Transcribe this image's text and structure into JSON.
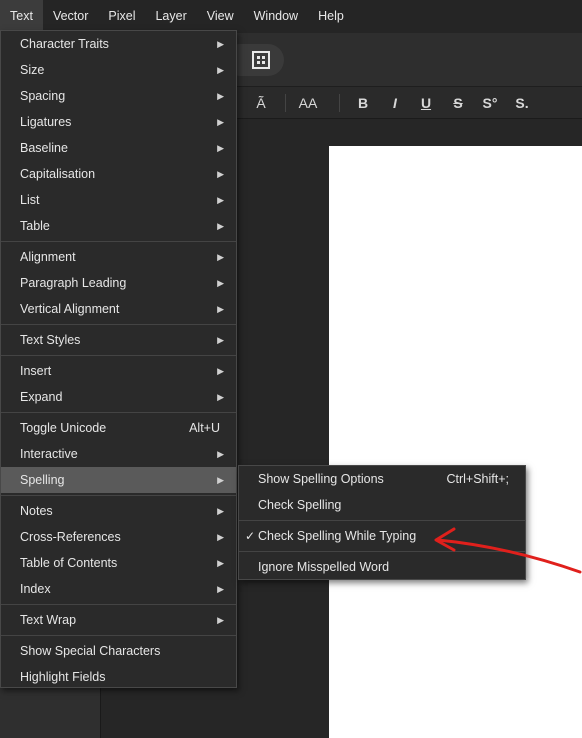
{
  "menubar": {
    "items": [
      "Text",
      "Vector",
      "Pixel",
      "Layer",
      "View",
      "Window",
      "Help"
    ],
    "active": "Text"
  },
  "format_toolbar": {
    "buttons": [
      "Ã",
      "AA",
      "B",
      "I",
      "U",
      "S",
      "S°",
      "S."
    ]
  },
  "text_menu": {
    "groups": [
      [
        {
          "label": "Character Traits",
          "submenu": true
        },
        {
          "label": "Size",
          "submenu": true
        },
        {
          "label": "Spacing",
          "submenu": true
        },
        {
          "label": "Ligatures",
          "submenu": true
        },
        {
          "label": "Baseline",
          "submenu": true
        },
        {
          "label": "Capitalisation",
          "submenu": true
        },
        {
          "label": "List",
          "submenu": true
        },
        {
          "label": "Table",
          "submenu": true
        }
      ],
      [
        {
          "label": "Alignment",
          "submenu": true
        },
        {
          "label": "Paragraph Leading",
          "submenu": true
        },
        {
          "label": "Vertical Alignment",
          "submenu": true
        }
      ],
      [
        {
          "label": "Text Styles",
          "submenu": true
        }
      ],
      [
        {
          "label": "Insert",
          "submenu": true
        },
        {
          "label": "Expand",
          "submenu": true
        }
      ],
      [
        {
          "label": "Toggle Unicode",
          "shortcut": "Alt+U"
        },
        {
          "label": "Interactive",
          "submenu": true
        },
        {
          "label": "Spelling",
          "submenu": true,
          "highlighted": true
        }
      ],
      [
        {
          "label": "Notes",
          "submenu": true
        },
        {
          "label": "Cross-References",
          "submenu": true
        },
        {
          "label": "Table of Contents",
          "submenu": true
        },
        {
          "label": "Index",
          "submenu": true
        }
      ],
      [
        {
          "label": "Text Wrap",
          "submenu": true
        }
      ],
      [
        {
          "label": "Show Special Characters"
        },
        {
          "label": "Highlight Fields"
        }
      ]
    ]
  },
  "spelling_submenu": {
    "items": [
      {
        "label": "Show Spelling Options",
        "shortcut": "Ctrl+Shift+;"
      },
      {
        "label": "Check Spelling"
      },
      {
        "separator": true
      },
      {
        "label": "Check Spelling While Typing",
        "checked": true
      },
      {
        "separator": true
      },
      {
        "label": "Ignore Misspelled Word"
      }
    ]
  },
  "icons": {
    "submenu_arrow": "chevron-right-icon",
    "check": "checkmark-icon"
  },
  "colors": {
    "menu_bg": "#2a2a2a",
    "highlight": "#5a5a5a",
    "annotation": "#e0201c"
  }
}
